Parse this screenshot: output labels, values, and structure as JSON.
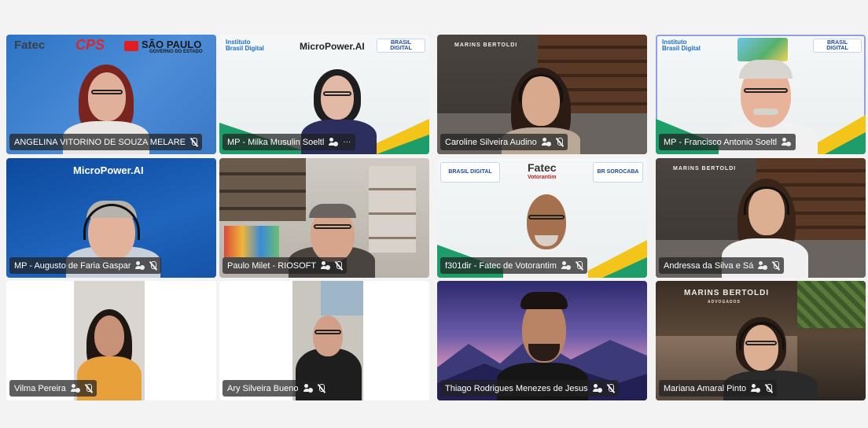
{
  "participants": [
    {
      "name": "ANGELINA VITORINO DE SOUZA MELARE",
      "muted": true,
      "extra_icon": "",
      "logos": [
        "Fatec",
        "CPS",
        "SÃO PAULO"
      ],
      "logo_subtitle": "GOVERNO DO ESTADO"
    },
    {
      "name": "MP - Milka Musulin Soeltl",
      "muted": false,
      "extra_icon": "more-options",
      "logos": [
        "Instituto Brasil Digital",
        "MicroPower.AI"
      ]
    },
    {
      "name": "Caroline Silveira Audino",
      "muted": true,
      "extra_icon": "",
      "logos": [
        "MARINS BERTOLDI"
      ]
    },
    {
      "name": "MP - Francisco Antonio Soeltl",
      "muted": false,
      "extra_icon": "",
      "logos": [
        "Instituto Brasil Digital"
      ],
      "speaking": true
    },
    {
      "name": "MP - Augusto de Faria Gaspar",
      "muted": true,
      "extra_icon": "",
      "logos": [
        "MicroPower.AI"
      ]
    },
    {
      "name": "Paulo Milet - RIOSOFT",
      "muted": true,
      "extra_icon": "",
      "logos": []
    },
    {
      "name": "f301dir - Fatec de Votorantim",
      "muted": true,
      "extra_icon": "",
      "logos": [
        "Fatec",
        "Votorantim",
        "BRASIL DIGITAL",
        "BR SOROCABA"
      ]
    },
    {
      "name": "Andressa da Silva e Sá",
      "muted": true,
      "extra_icon": "",
      "logos": [
        "MARINS BERTOLDI"
      ]
    },
    {
      "name": "Vilma Pereira",
      "muted": true,
      "extra_icon": "",
      "logos": []
    },
    {
      "name": "Ary Silveira Bueno",
      "muted": true,
      "extra_icon": "",
      "logos": []
    },
    {
      "name": "Thiago Rodrigues Menezes de Jesus",
      "muted": true,
      "extra_icon": "",
      "logos": []
    },
    {
      "name": "Mariana Amaral Pinto",
      "muted": true,
      "extra_icon": "",
      "logos": [
        "MARINS BERTOLDI"
      ],
      "logo_subtitle": "ADVOGADOS"
    }
  ],
  "colors": {
    "speaking_border": "#8fa0e6",
    "nametag_bg": "#202020"
  }
}
